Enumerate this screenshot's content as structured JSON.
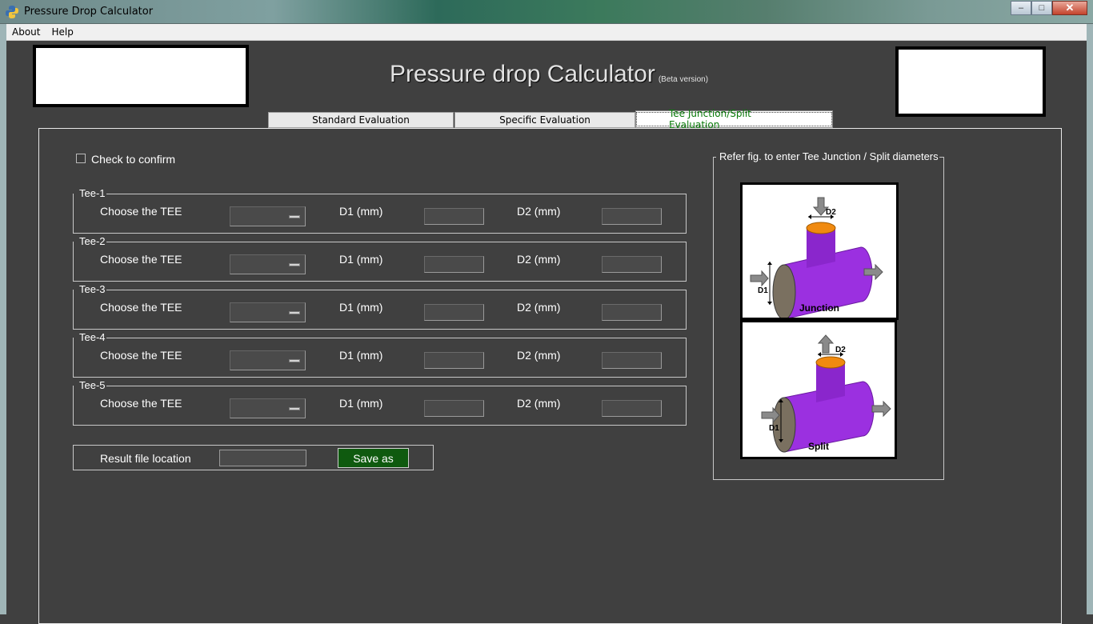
{
  "window": {
    "title": "Pressure Drop Calculator"
  },
  "menu": [
    "About",
    "Help"
  ],
  "header": {
    "title": "Pressure drop Calculator",
    "subtitle": "(Beta version)"
  },
  "tabs": [
    {
      "label": "Standard Evaluation",
      "active": false
    },
    {
      "label": "Specific Evaluation",
      "active": false
    },
    {
      "label": "Tee Junction/Split Evaluation",
      "active": true
    }
  ],
  "confirm": {
    "label": "Check to confirm",
    "checked": false
  },
  "tees": [
    {
      "title": "Tee-1",
      "choose_label": "Choose the TEE",
      "selected": "",
      "d1_label": "D1 (mm)",
      "d1_value": "",
      "d2_label": "D2 (mm)",
      "d2_value": ""
    },
    {
      "title": "Tee-2",
      "choose_label": "Choose the TEE",
      "selected": "",
      "d1_label": "D1 (mm)",
      "d1_value": "",
      "d2_label": "D2 (mm)",
      "d2_value": ""
    },
    {
      "title": "Tee-3",
      "choose_label": "Choose the TEE",
      "selected": "",
      "d1_label": "D1 (mm)",
      "d1_value": "",
      "d2_label": "D2 (mm)",
      "d2_value": ""
    },
    {
      "title": "Tee-4",
      "choose_label": "Choose the TEE",
      "selected": "",
      "d1_label": "D1 (mm)",
      "d1_value": "",
      "d2_label": "D2 (mm)",
      "d2_value": ""
    },
    {
      "title": "Tee-5",
      "choose_label": "Choose the TEE",
      "selected": "",
      "d1_label": "D1 (mm)",
      "d1_value": "",
      "d2_label": "D2 (mm)",
      "d2_value": ""
    }
  ],
  "result": {
    "label": "Result file location",
    "value": "",
    "save_label": "Save as"
  },
  "figure": {
    "title": "Refer fig. to enter Tee Junction / Split diameters",
    "junction": {
      "caption": "Junction",
      "d1": "D1",
      "d2": "D2"
    },
    "split": {
      "caption": "Split",
      "d1": "D1",
      "d2": "D2"
    }
  },
  "colors": {
    "background": "#404040",
    "save_button": "#0f5a0f",
    "active_tab_text": "#0a7a0a",
    "pipe": "#9b30e0",
    "pipe_outlet": "#f08a10"
  }
}
